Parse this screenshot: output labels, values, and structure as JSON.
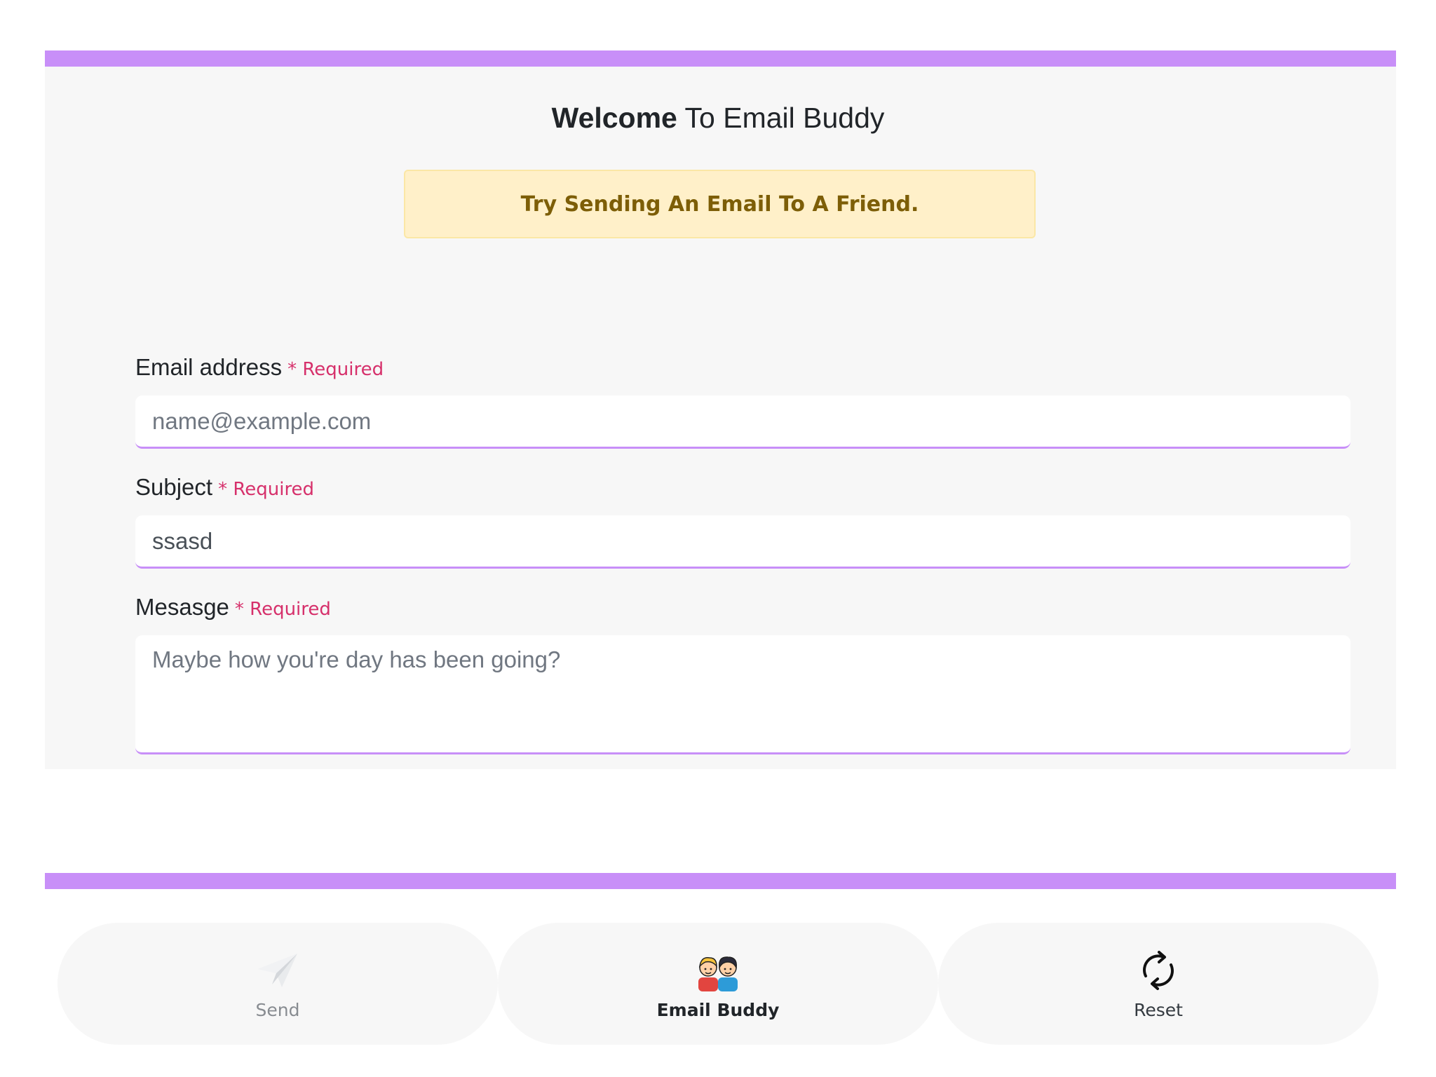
{
  "header": {
    "title_bold": "Welcome",
    "title_rest": " To Email Buddy"
  },
  "alert": {
    "text": "Try Sending An Email To A Friend."
  },
  "form": {
    "email": {
      "label": "Email address",
      "required": "* Required",
      "value": "",
      "placeholder": "name@example.com"
    },
    "subject": {
      "label": "Subject",
      "required": "* Required",
      "value": "ssasd",
      "placeholder": ""
    },
    "message": {
      "label": "Mesasge",
      "required": "* Required",
      "value": "",
      "placeholder": "Maybe how you're day has been going?"
    }
  },
  "nav": {
    "send": {
      "label": "Send",
      "icon": "paper-plane-icon"
    },
    "buddy": {
      "label": "Email Buddy",
      "icon": "friends-icon"
    },
    "reset": {
      "label": "Reset",
      "icon": "refresh-icon"
    }
  },
  "colors": {
    "accent": "#c88ff8",
    "alert_bg": "#fff0c9",
    "alert_text": "#7d5e07",
    "required": "#d6306b"
  }
}
